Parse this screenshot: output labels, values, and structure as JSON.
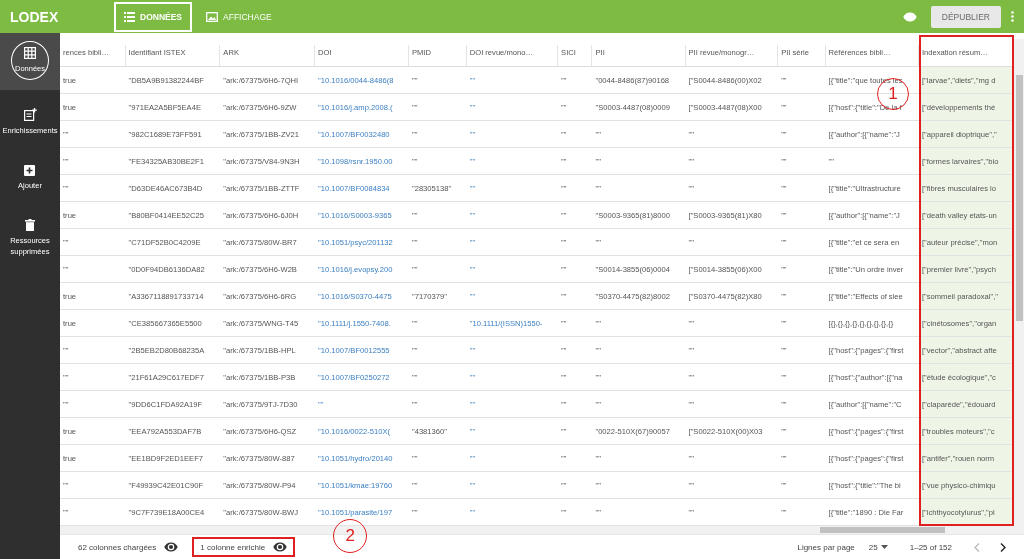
{
  "app": {
    "logo": "LODEX"
  },
  "nav_tabs": [
    {
      "label": "DONNÉES",
      "selected": true,
      "outlined": true
    },
    {
      "label": "AFFICHAGE",
      "selected": false,
      "outlined": false
    }
  ],
  "top_actions": {
    "publish_button": "DÉPUBLIER"
  },
  "sidebar": {
    "items": [
      {
        "label": "Données",
        "selected": true,
        "outlined": true
      },
      {
        "label": "Enrichissements",
        "selected": false,
        "outlined": false
      },
      {
        "label": "Ajouter",
        "selected": false,
        "outlined": false
      },
      {
        "label": "Ressources supprimées",
        "selected": false,
        "outlined": false
      }
    ]
  },
  "table": {
    "columns": [
      {
        "label": "rences bibli…",
        "kind": "text",
        "enriched": false,
        "highlighted": false
      },
      {
        "label": "Identifiant ISTEX",
        "kind": "text",
        "enriched": false,
        "highlighted": false
      },
      {
        "label": "ARK",
        "kind": "text",
        "enriched": false,
        "highlighted": false
      },
      {
        "label": "DOI",
        "kind": "link",
        "enriched": false,
        "highlighted": false
      },
      {
        "label": "PMID",
        "kind": "text",
        "enriched": false,
        "highlighted": false
      },
      {
        "label": "DOI revue/mono…",
        "kind": "link",
        "enriched": false,
        "highlighted": false
      },
      {
        "label": "SICI",
        "kind": "text",
        "enriched": false,
        "highlighted": false
      },
      {
        "label": "PII",
        "kind": "text",
        "enriched": false,
        "highlighted": false
      },
      {
        "label": "PII revue/monogr…",
        "kind": "text",
        "enriched": false,
        "highlighted": false
      },
      {
        "label": "PII série",
        "kind": "text",
        "enriched": false,
        "highlighted": false
      },
      {
        "label": "Références bibli…",
        "kind": "text",
        "enriched": false,
        "highlighted": false
      },
      {
        "label": "Indexation résum…",
        "kind": "text",
        "enriched": true,
        "highlighted": true,
        "callout": "1"
      }
    ],
    "rows": [
      [
        "true",
        "\"DB5A9B91382244BF",
        "\"ark:/67375/6H6-7QHI",
        "\"10.1016/0044-8486(8",
        "\"\"",
        "\"\"",
        "\"\"",
        "\"0044-8486(87)90168",
        "[\"S0044-8486(00)X02",
        "\"\"",
        "[{\"title\":\"que toutes les",
        "[\"larvae\",\"diets\",\"mg d"
      ],
      [
        "true",
        "\"971EA2A5BF5EA4E",
        "\"ark:/67375/6H6-9ZW",
        "\"10.1016/j.amp.2008.(",
        "\"\"",
        "\"\"",
        "\"\"",
        "\"S0003-4487(08)0009",
        "[\"S0003-4487(08)X00",
        "\"\"",
        "[{\"host\":{\"title\":\"De la f",
        "[\"développements thé"
      ],
      [
        "\"\"",
        "\"982C1689E73FF591",
        "\"ark:/67375/1BB-ZV21",
        "\"10.1007/BF0032480",
        "\"\"",
        "\"\"",
        "\"\"",
        "\"\"",
        "\"\"",
        "\"\"",
        "[{\"author\":[{\"name\":\"J",
        "[\"appareil dioptrique\",\""
      ],
      [
        "\"\"",
        "\"FE34325AB30BE2F1",
        "\"ark:/67375/V84-9N3H",
        "\"10.1098/rsnr.1950.00",
        "\"\"",
        "\"\"",
        "\"\"",
        "\"\"",
        "\"\"",
        "\"\"",
        "\"\"",
        "[\"formes larvaires\",\"bio"
      ],
      [
        "\"\"",
        "\"D63DE46AC673B4D",
        "\"ark:/67375/1BB-ZTTF",
        "\"10.1007/BF0084834",
        "\"28305138\"",
        "\"\"",
        "\"\"",
        "\"\"",
        "\"\"",
        "\"\"",
        "[{\"title\":\"Ultrastructure",
        "[\"fibres musculaires lo"
      ],
      [
        "true",
        "\"B80BF0414EE52C25",
        "\"ark:/67375/6H6-6J0H",
        "\"10.1016/S0003-9365",
        "\"\"",
        "\"\"",
        "\"\"",
        "\"S0003-9365(81)8000",
        "[\"S0003-9365(81)X80",
        "\"\"",
        "[{\"author\":[{\"name\":\"J",
        "[\"death valley etats-un"
      ],
      [
        "\"\"",
        "\"C71DF52B0C4209E",
        "\"ark:/67375/80W-BR7",
        "\"10.1051/psyc/201132",
        "\"\"",
        "\"\"",
        "\"\"",
        "\"\"",
        "\"\"",
        "\"\"",
        "[{\"title\":\"et ce sera en",
        "[\"auteur précise\",\"mon"
      ],
      [
        "\"\"",
        "\"0D0F94DB6136DA82",
        "\"ark:/67375/6H6-W2B",
        "\"10.1016/j.evopsy.200",
        "\"\"",
        "\"\"",
        "\"\"",
        "\"S0014-3855(06)0004",
        "[\"S0014-3855(06)X00",
        "\"\"",
        "[{\"title\":\"Un ordre inver",
        "[\"premier livre\",\"psych"
      ],
      [
        "true",
        "\"A3367118891733714",
        "\"ark:/67375/6H6-6RG",
        "\"10.1016/S0370-4475",
        "\"7170379\"",
        "\"\"",
        "\"\"",
        "\"S0370-4475(82)8002",
        "[\"S0370-4475(82)X80",
        "\"\"",
        "[{\"title\":\"Effects of slee",
        "[\"sommeil paradoxal\",\""
      ],
      [
        "true",
        "\"CE385667365E5500",
        "\"ark:/67375/WNG-T45",
        "\"10.1111/j.1550-7408.",
        "\"\"",
        "\"10.1111/(ISSN)1550-",
        "\"\"",
        "\"\"",
        "\"\"",
        "\"\"",
        "[{},{},{},{},{},{},{},{},{}",
        "[\"cinétosomes\",\"organ"
      ],
      [
        "\"\"",
        "\"2B5EB2D80B68235A",
        "\"ark:/67375/1BB-HPL",
        "\"10.1007/BF0012555",
        "\"\"",
        "\"\"",
        "\"\"",
        "\"\"",
        "\"\"",
        "\"\"",
        "[{\"host\":{\"pages\":{\"first",
        "[\"vector\",\"abstract afte"
      ],
      [
        "\"\"",
        "\"21F61A29C617EDF7",
        "\"ark:/67375/1BB-P3B",
        "\"10.1007/BF0250272",
        "\"\"",
        "\"\"",
        "\"\"",
        "\"\"",
        "\"\"",
        "\"\"",
        "[{\"host\":{\"author\":[{\"na",
        "[\"étude écologique\",\"c"
      ],
      [
        "\"\"",
        "\"9DD6C1FDA92A19F",
        "\"ark:/67375/9TJ-7D30",
        "\"\"",
        "\"\"",
        "\"\"",
        "\"\"",
        "\"\"",
        "\"\"",
        "\"\"",
        "[{\"author\":[{\"name\":\"C",
        "[\"claparède\",\"édouard"
      ],
      [
        "true",
        "\"EEA792A553DAF7B",
        "\"ark:/67375/6H6-QSZ",
        "\"10.1016/0022-510X(",
        "\"4381360\"",
        "\"\"",
        "\"\"",
        "\"0022-510X(67)90057",
        "[\"S0022-510X(00)X03",
        "\"\"",
        "[{\"host\":{\"pages\":{\"first",
        "[\"troubles moteurs\",\"c"
      ],
      [
        "true",
        "\"EE1BD9F2ED1EEF7",
        "\"ark:/67375/80W-887",
        "\"10.1051/hydro/20140",
        "\"\"",
        "\"\"",
        "\"\"",
        "\"\"",
        "\"\"",
        "\"\"",
        "[{\"host\":{\"pages\":{\"first",
        "[\"antifer\",\"rouen norm"
      ],
      [
        "\"\"",
        "\"F49939C42E01C90F",
        "\"ark:/67375/80W-P94",
        "\"10.1051/kmae:19760",
        "\"\"",
        "\"\"",
        "\"\"",
        "\"\"",
        "\"\"",
        "\"\"",
        "[{\"host\":{\"title\":\"The bi",
        "[\"vue physico-chimiqu"
      ],
      [
        "\"\"",
        "\"9C7F739E18A00CE4",
        "\"ark:/67375/80W-BWJ",
        "\"10.1051/parasite/197",
        "\"\"",
        "\"\"",
        "\"\"",
        "\"\"",
        "\"\"",
        "\"\"",
        "[{\"title\":\"1890 : Die Far",
        "[\"ichthyocotylurus\",\"pl"
      ]
    ]
  },
  "footer": {
    "loaded_columns": {
      "text": "62 colonnes chargées",
      "highlighted": false
    },
    "enriched_columns": {
      "text": "1 colonne enrichie",
      "highlighted": true,
      "callout": "2"
    },
    "rows_per_page_label": "Lignes par page",
    "rows_per_page": "25",
    "range": "1–25 of 152"
  }
}
